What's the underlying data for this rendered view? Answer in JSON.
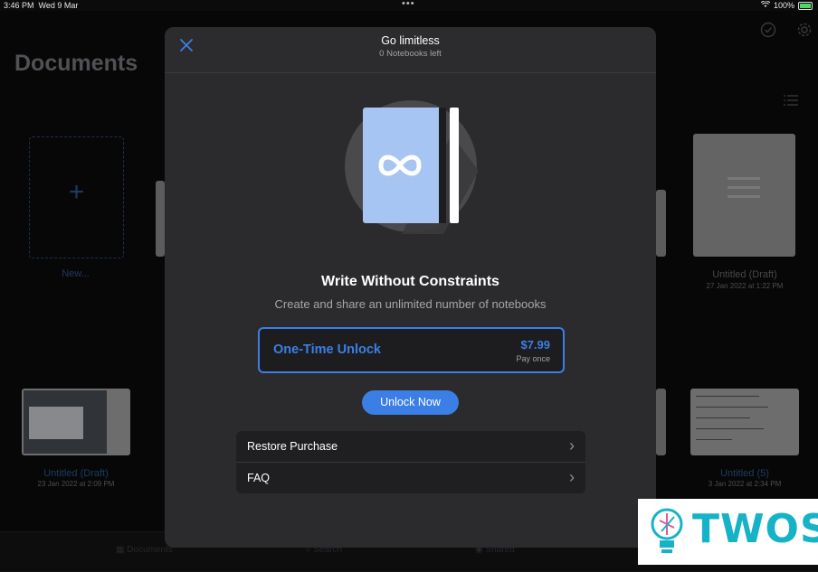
{
  "status_bar": {
    "time": "3:46 PM",
    "date": "Wed 9 Mar",
    "dots": "•••",
    "battery": "100%",
    "icons": [
      "wifi-icon",
      "battery-icon"
    ]
  },
  "background": {
    "title": "Documents",
    "new_label": "New...",
    "docs": [
      {
        "name": "Untitled (Draft)",
        "date": "27 Jan 2022 at 1:22 PM"
      },
      {
        "name": "Untitled (Draft)",
        "date": "23 Jan 2022 at 2:09 PM"
      },
      {
        "name": "Untitled (5)",
        "date": "3 Jan 2022 at 2:34 PM"
      }
    ],
    "tabs": {
      "documents": "Documents",
      "search": "Search",
      "shared": "Shared"
    }
  },
  "modal": {
    "title": "Go limitless",
    "subtitle": "0 Notebooks left",
    "headline": "Write Without Constraints",
    "description": "Create and share an unlimited number of notebooks",
    "plan": {
      "name": "One-Time Unlock",
      "price": "$7.99",
      "note": "Pay once"
    },
    "cta": "Unlock Now",
    "list": [
      {
        "label": "Restore Purchase"
      },
      {
        "label": "FAQ"
      }
    ]
  },
  "watermark": {
    "text": "TWOS"
  },
  "colors": {
    "accent": "#3b7fe6",
    "modal_bg": "#2b2b2d",
    "watermark": "#16b3c8"
  }
}
